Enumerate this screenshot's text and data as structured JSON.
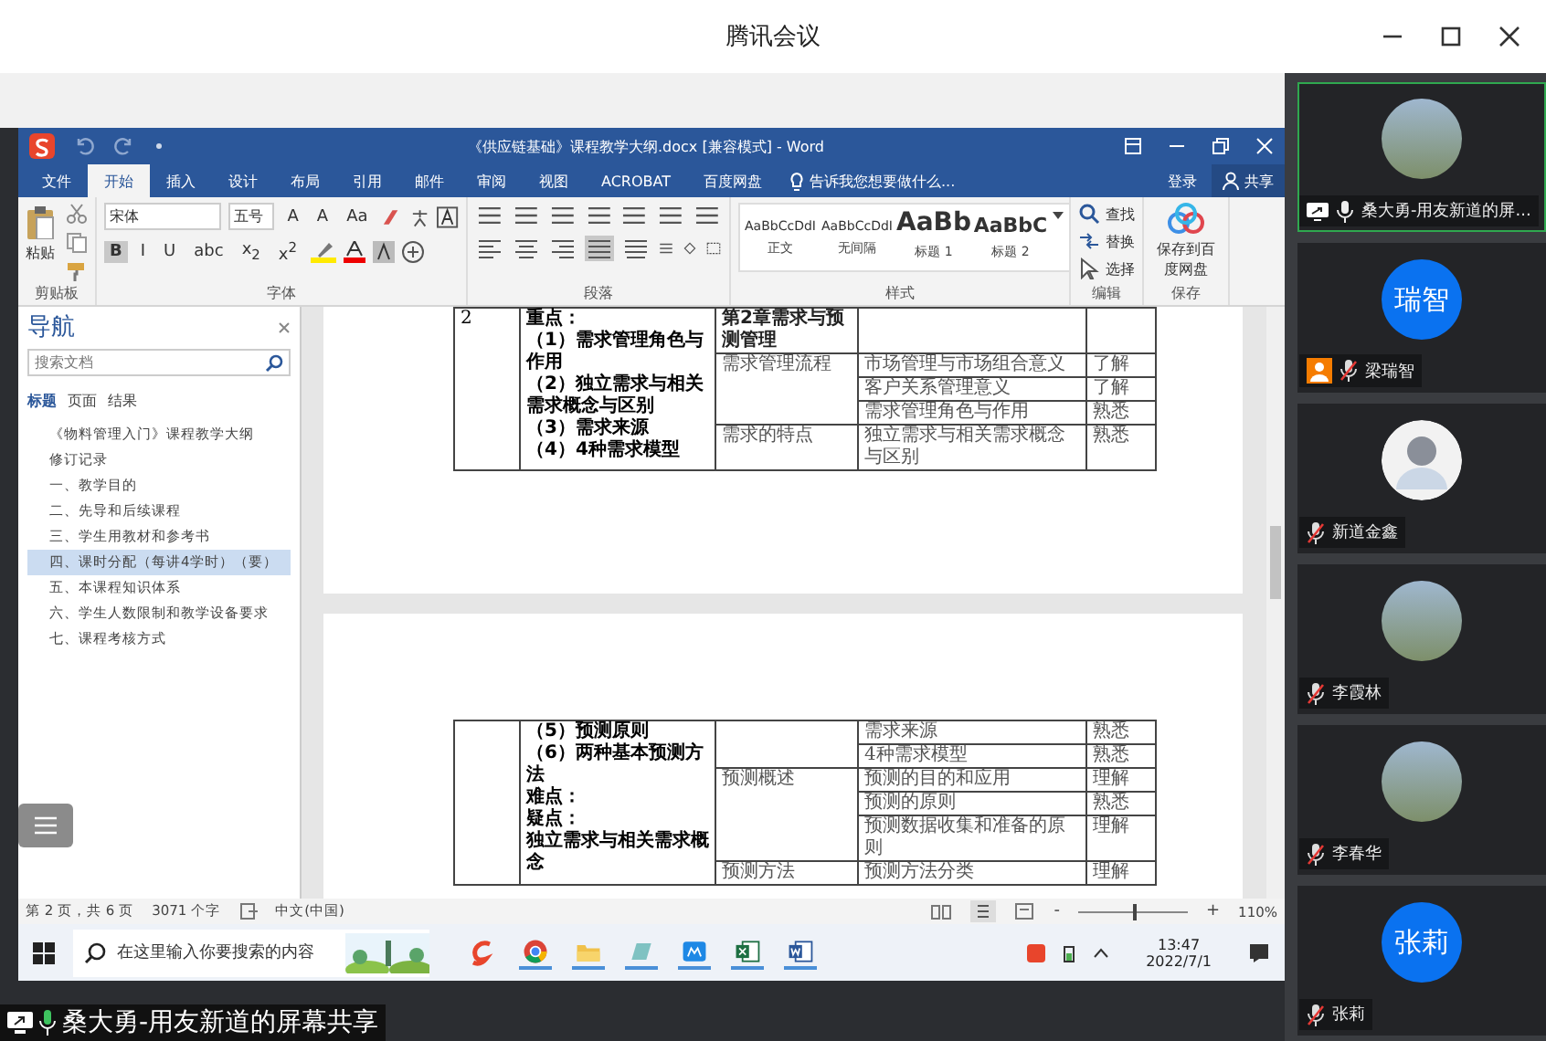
{
  "app": {
    "title": "腾讯会议"
  },
  "word": {
    "title": "《供应链基础》课程教学大纲.docx [兼容模式] - Word",
    "tabs": [
      {
        "label": "文件",
        "selected": false
      },
      {
        "label": "开始",
        "selected": true
      },
      {
        "label": "插入",
        "selected": false
      },
      {
        "label": "设计",
        "selected": false
      },
      {
        "label": "布局",
        "selected": false
      },
      {
        "label": "引用",
        "selected": false
      },
      {
        "label": "邮件",
        "selected": false
      },
      {
        "label": "审阅",
        "selected": false
      },
      {
        "label": "视图",
        "selected": false
      },
      {
        "label": "ACROBAT",
        "selected": false
      },
      {
        "label": "百度网盘",
        "selected": false
      }
    ],
    "tell_me": "告诉我您想要做什么...",
    "sign_in": "登录",
    "share": "共享",
    "ribbon": {
      "clipboard": {
        "paste": "粘贴",
        "label": "剪贴板"
      },
      "font": {
        "name": "宋体",
        "size": "五号",
        "row1": [
          "A",
          "A",
          "Aa"
        ],
        "row2": [
          {
            "label": "B",
            "selected": true
          },
          {
            "label": "I",
            "selected": false
          },
          {
            "label": "U",
            "selected": false
          },
          {
            "label": "abc",
            "selected": false
          },
          {
            "label": "x$_{2}$",
            "selected": false
          },
          {
            "label": "x$^{2}$",
            "selected": false
          }
        ],
        "label": "字体"
      },
      "paragraph": {
        "alignment": [
          {
            "kind": "left",
            "selected": false
          },
          {
            "kind": "center",
            "selected": false
          },
          {
            "kind": "right",
            "selected": false
          },
          {
            "kind": "justify",
            "selected": true
          },
          {
            "kind": "distributed",
            "selected": false
          }
        ],
        "label": "段落"
      },
      "styles": {
        "items": [
          {
            "sample": "AaBbCcDdI",
            "name": "正文",
            "kind": "normal"
          },
          {
            "sample": "AaBbCcDdI",
            "name": "无间隔",
            "kind": "normal"
          },
          {
            "sample": "AaBb",
            "name": "标题 1",
            "kind": "heading1"
          },
          {
            "sample": "AaBbC",
            "name": "标题 2",
            "kind": "heading2"
          }
        ],
        "label": "样式"
      },
      "editing": {
        "items": [
          "查找",
          "替换",
          "选择"
        ],
        "label": "编辑"
      },
      "save": {
        "button": "保存到百度网盘",
        "label": "保存"
      }
    },
    "navigation": {
      "title": "导航",
      "placeholder": "搜索文档",
      "tabs": [
        {
          "label": "标题",
          "selected": true
        },
        {
          "label": "页面",
          "selected": false
        },
        {
          "label": "结果",
          "selected": false
        }
      ],
      "items": [
        {
          "label": "《物料管理入门》课程教学大纲",
          "selected": false
        },
        {
          "label": "修订记录",
          "selected": false
        },
        {
          "label": "一、教学目的",
          "selected": false
        },
        {
          "label": "二、先导和后续课程",
          "selected": false
        },
        {
          "label": "三、学生用教材和参考书",
          "selected": false
        },
        {
          "label": "四、课时分配（每讲4学时）（要）",
          "selected": true
        },
        {
          "label": "五、本课程知识体系",
          "selected": false
        },
        {
          "label": "六、学生人数限制和教学设备要求",
          "selected": false
        },
        {
          "label": "七、课程考核方式",
          "selected": false
        }
      ]
    },
    "pages": [
      {
        "number": "2",
        "key_points": [
          "重点：",
          "（1）需求管理角色与作用",
          "（2）独立需求与相关需求概念与区别",
          "（3）需求来源",
          "（4）4种需求模型"
        ],
        "sections": [
          {
            "title": "第2章需求与预测管理",
            "kind": "chapter"
          },
          {
            "title": "需求管理流程",
            "kind": "topic",
            "items": [
              {
                "content": "市场管理与市场组合意义",
                "level": "了解"
              },
              {
                "content": "客户关系管理意义",
                "level": "了解"
              },
              {
                "content": "需求管理角色与作用",
                "level": "熟悉"
              }
            ]
          },
          {
            "title": "需求的特点",
            "kind": "topic",
            "items": [
              {
                "content": "独立需求与相关需求概念与区别",
                "level": "熟悉"
              }
            ]
          }
        ]
      },
      {
        "key_points": [
          "（5）预测原则",
          "（6）两种基本预测方法",
          "难点：",
          "疑点：",
          "独立需求与相关需求概念"
        ],
        "sections": [
          {
            "kind": "topic",
            "items": [
              {
                "content": "需求来源",
                "level": "熟悉"
              },
              {
                "content": "4种需求模型",
                "level": "熟悉"
              }
            ]
          },
          {
            "title": "预测概述",
            "kind": "topic",
            "items": [
              {
                "content": "预测的目的和应用",
                "level": "理解"
              },
              {
                "content": "预测的原则",
                "level": "熟悉"
              },
              {
                "content": "预测数据收集和准备的原则",
                "level": "理解"
              }
            ]
          },
          {
            "title": "预测方法",
            "kind": "topic",
            "items": [
              {
                "content": "预测方法分类",
                "level": "理解"
              }
            ]
          }
        ]
      }
    ],
    "status_bar": {
      "page": "第 2 页，共 6 页",
      "words": "3071 个字",
      "language": "中文(中国)",
      "zoom_out": "-",
      "zoom_in": "+",
      "zoom": {
        "level": 0.5
      },
      "zoom_text": "110%"
    }
  },
  "taskbar": {
    "placeholder": "在这里输入你要搜索的内容",
    "time": "13:47",
    "date": "2022/7/1"
  },
  "caption": {
    "text": "桑大勇-用友新道的屏幕共享"
  },
  "participants": [
    {
      "name": "桑大勇-用友新道的屏...",
      "avatar": {
        "kind": "photo"
      },
      "sharing": true,
      "muted": false,
      "host": false,
      "speaking": true
    },
    {
      "name": "梁瑞智",
      "avatar": {
        "kind": "initials",
        "text": "瑞智"
      },
      "sharing": false,
      "muted": true,
      "host": true,
      "speaking": false
    },
    {
      "name": "新道金鑫",
      "avatar": {
        "kind": "person"
      },
      "sharing": false,
      "muted": true,
      "host": false,
      "speaking": false
    },
    {
      "name": "李霞林",
      "avatar": {
        "kind": "photo"
      },
      "sharing": false,
      "muted": true,
      "host": false,
      "speaking": false
    },
    {
      "name": "李春华",
      "avatar": {
        "kind": "photo"
      },
      "sharing": false,
      "muted": true,
      "host": false,
      "speaking": false
    },
    {
      "name": "张莉",
      "avatar": {
        "kind": "initials",
        "text": "张莉"
      },
      "sharing": false,
      "muted": true,
      "host": false,
      "speaking": false
    }
  ]
}
